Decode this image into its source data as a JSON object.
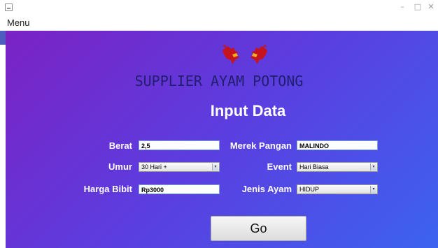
{
  "window": {
    "minimize_glyph": "–",
    "maximize_glyph": "□",
    "close_glyph": "✕"
  },
  "menubar": {
    "items": [
      {
        "label": "Menu"
      }
    ]
  },
  "header": {
    "logo_icon": "roosters-logo-icon",
    "brand": "SUPPLIER AYAM POTONG",
    "title": "Input Data"
  },
  "form": {
    "berat": {
      "label": "Berat",
      "value": "2,5"
    },
    "umur": {
      "label": "Umur",
      "value": "30 Hari +"
    },
    "harga_bibit": {
      "label": "Harga Bibit",
      "value": "Rp3000"
    },
    "merek_pangan": {
      "label": "Merek Pangan",
      "value": "MALINDO"
    },
    "event": {
      "label": "Event",
      "value": "Hari Biasa"
    },
    "jenis_ayam": {
      "label": "Jenis Ayam",
      "value": "HIDUP"
    },
    "submit_label": "Go"
  },
  "colors": {
    "gradient_start": "#7b22c4",
    "gradient_mid": "#5b3ee0",
    "gradient_end": "#3c63f0",
    "brand_text": "#1f1f6e",
    "label_text": "#ffffff"
  }
}
